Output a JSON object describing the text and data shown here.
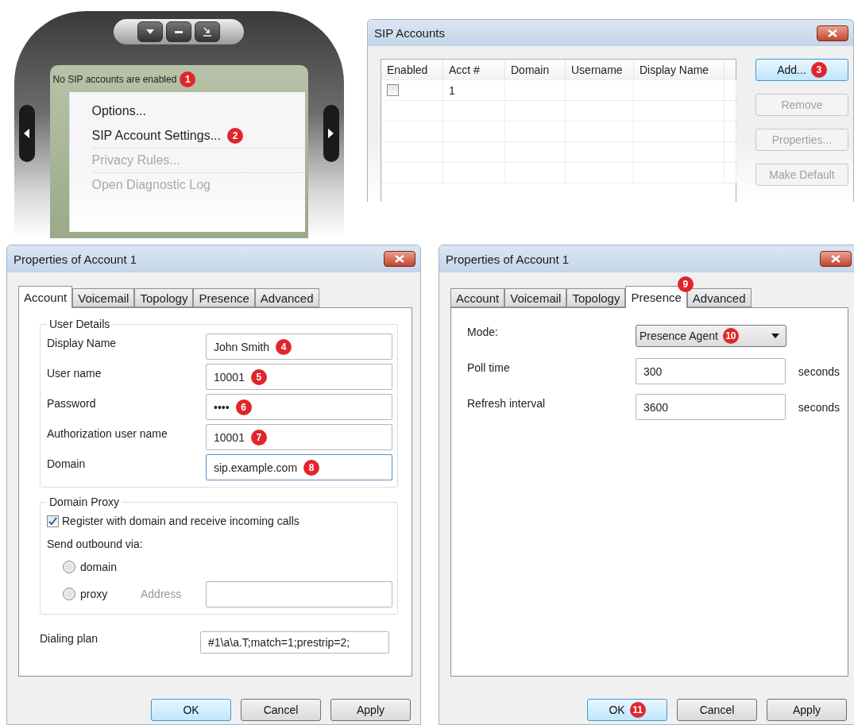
{
  "phone": {
    "status": "No SIP accounts are enabled",
    "status_badge": "1",
    "menu": [
      {
        "label": "Options...",
        "disabled": false,
        "separator_before": false
      },
      {
        "label": "SIP Account Settings...",
        "disabled": false,
        "separator_before": false,
        "badge": "2"
      },
      {
        "label": "Privacy Rules...",
        "disabled": true,
        "separator_before": true
      },
      {
        "label": "Open Diagnostic Log",
        "disabled": true,
        "separator_before": true
      }
    ]
  },
  "sip_accounts": {
    "title": "SIP Accounts",
    "columns": [
      "Enabled",
      "Acct #",
      "Domain",
      "Username",
      "Display Name"
    ],
    "rows": [
      {
        "enabled": false,
        "acct": "1"
      }
    ],
    "buttons": [
      {
        "label": "Add...",
        "disabled": false,
        "default": true,
        "badge": "3"
      },
      {
        "label": "Remove",
        "disabled": true,
        "default": false
      },
      {
        "label": "Properties...",
        "disabled": true,
        "default": false
      },
      {
        "label": "Make Default",
        "disabled": true,
        "default": false
      }
    ]
  },
  "account_dialog": {
    "title": "Properties of Account 1",
    "tabs": [
      {
        "label": "Account",
        "selected": true
      },
      {
        "label": "Voicemail",
        "selected": false
      },
      {
        "label": "Topology",
        "selected": false
      },
      {
        "label": "Presence",
        "selected": false
      },
      {
        "label": "Advanced",
        "selected": false
      }
    ],
    "user_details": {
      "legend": "User Details",
      "fields": [
        {
          "label": "Display Name",
          "value": "John Smith",
          "badge": "4",
          "focused": false
        },
        {
          "label": "User name",
          "value": "10001",
          "badge": "5",
          "focused": false
        },
        {
          "label": "Password",
          "value": "••••",
          "badge": "6",
          "focused": false
        },
        {
          "label": "Authorization user name",
          "value": "10001",
          "badge": "7",
          "focused": false
        },
        {
          "label": "Domain",
          "value": "sip.example.com",
          "badge": "8",
          "focused": true
        }
      ]
    },
    "domain_proxy": {
      "legend": "Domain Proxy",
      "register": {
        "label": "Register with domain and receive incoming calls",
        "checked": true
      },
      "outbound_label": "Send outbound via:",
      "options": [
        {
          "label": "domain",
          "selected": false
        },
        {
          "label": "proxy",
          "selected": false
        }
      ],
      "address_label": "Address"
    },
    "dialing_plan": {
      "label": "Dialing plan",
      "value": "#1\\a\\a.T;match=1;prestrip=2;"
    },
    "buttons": [
      {
        "label": "OK",
        "default": true
      },
      {
        "label": "Cancel",
        "default": false
      },
      {
        "label": "Apply",
        "default": false
      }
    ]
  },
  "presence_dialog": {
    "title": "Properties of Account 1",
    "tabs": [
      {
        "label": "Account",
        "selected": false
      },
      {
        "label": "Voicemail",
        "selected": false
      },
      {
        "label": "Topology",
        "selected": false
      },
      {
        "label": "Presence",
        "selected": true,
        "badge": "9"
      },
      {
        "label": "Advanced",
        "selected": false
      }
    ],
    "mode": {
      "label": "Mode:",
      "value": "Presence Agent",
      "badge": "10"
    },
    "fields": [
      {
        "label": "Poll time",
        "value": "300",
        "unit": "seconds"
      },
      {
        "label": "Refresh interval",
        "value": "3600",
        "unit": "seconds"
      }
    ],
    "buttons": [
      {
        "label": "OK",
        "default": true,
        "badge": "11"
      },
      {
        "label": "Cancel",
        "default": false
      },
      {
        "label": "Apply",
        "default": false
      }
    ]
  }
}
